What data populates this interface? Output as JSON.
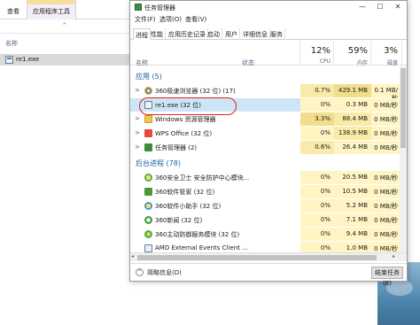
{
  "explorer": {
    "ribbon_tab_view": "查看",
    "ribbon_tab_app_tools": "应用程序工具",
    "column_name": "名称",
    "file_name": "re1.exe"
  },
  "taskmgr": {
    "title": "任务管理器",
    "controls": {
      "minimize": "—",
      "maximize": "☐",
      "close": "✕"
    },
    "menu": [
      "文件(F)",
      "选项(O)",
      "查看(V)"
    ],
    "tabs": [
      "进程",
      "性能",
      "应用历史记录",
      "启动",
      "用户",
      "详细信息",
      "服务"
    ],
    "columns": {
      "name": "名称",
      "status": "状态",
      "cpu_pct": "12%",
      "cpu_label": "CPU",
      "mem_pct": "59%",
      "mem_label": "内存",
      "disk_pct": "3%",
      "disk_label": "磁盘"
    },
    "sections": {
      "apps": "应用 (5)",
      "background": "后台进程 (78)"
    },
    "apps": [
      {
        "name": "360极速浏览器 (32 位) (17)",
        "expander": ">",
        "icon": "360-browser-icon",
        "cpu": "0.7%",
        "mem": "429.1 MB",
        "disk": "0.1 MB/秒"
      },
      {
        "name": "re1.exe (32 位)",
        "expander": "",
        "icon": "exe-icon",
        "cpu": "0%",
        "mem": "0.3 MB",
        "disk": "0 MB/秒"
      },
      {
        "name": "Windows 资源管理器",
        "expander": ">",
        "icon": "folder-icon",
        "cpu": "3.3%",
        "mem": "88.4 MB",
        "disk": "0 MB/秒"
      },
      {
        "name": "WPS Office (32 位)",
        "expander": ">",
        "icon": "wps-icon",
        "cpu": "0%",
        "mem": "138.9 MB",
        "disk": "0 MB/秒"
      },
      {
        "name": "任务管理器 (2)",
        "expander": ">",
        "icon": "task-manager-icon",
        "cpu": "0.6%",
        "mem": "26.4 MB",
        "disk": "0 MB/秒"
      }
    ],
    "background": [
      {
        "name": "360安全卫士 安全防护中心模块...",
        "icon": "360-safe-icon",
        "cpu": "0%",
        "mem": "20.5 MB",
        "disk": "0 MB/秒"
      },
      {
        "name": "360软件管家 (32 位)",
        "icon": "360-manager-icon",
        "cpu": "0%",
        "mem": "10.5 MB",
        "disk": "0 MB/秒"
      },
      {
        "name": "360软件小助手 (32 位)",
        "icon": "360-helper-icon",
        "cpu": "0%",
        "mem": "5.2 MB",
        "disk": "0 MB/秒"
      },
      {
        "name": "360新闻 (32 位)",
        "icon": "360-news-icon",
        "cpu": "0%",
        "mem": "7.1 MB",
        "disk": "0 MB/秒"
      },
      {
        "name": "360主动防御服务模块 (32 位)",
        "icon": "360-defense-icon",
        "cpu": "0%",
        "mem": "9.4 MB",
        "disk": "0 MB/秒"
      },
      {
        "name": "AMD External Events Client ...",
        "icon": "amd-icon",
        "cpu": "0%",
        "mem": "1.0 MB",
        "disk": "0 MB/秒"
      }
    ],
    "net_cut": "0",
    "footer": {
      "less_details": "简略信息(D)",
      "end_task": "结束任务(E)"
    }
  },
  "colors": {
    "section_title": "#1560a8",
    "selection": "#cde6f7",
    "highlight_circle": "#e0201a",
    "heat": "#f9eaa8"
  }
}
